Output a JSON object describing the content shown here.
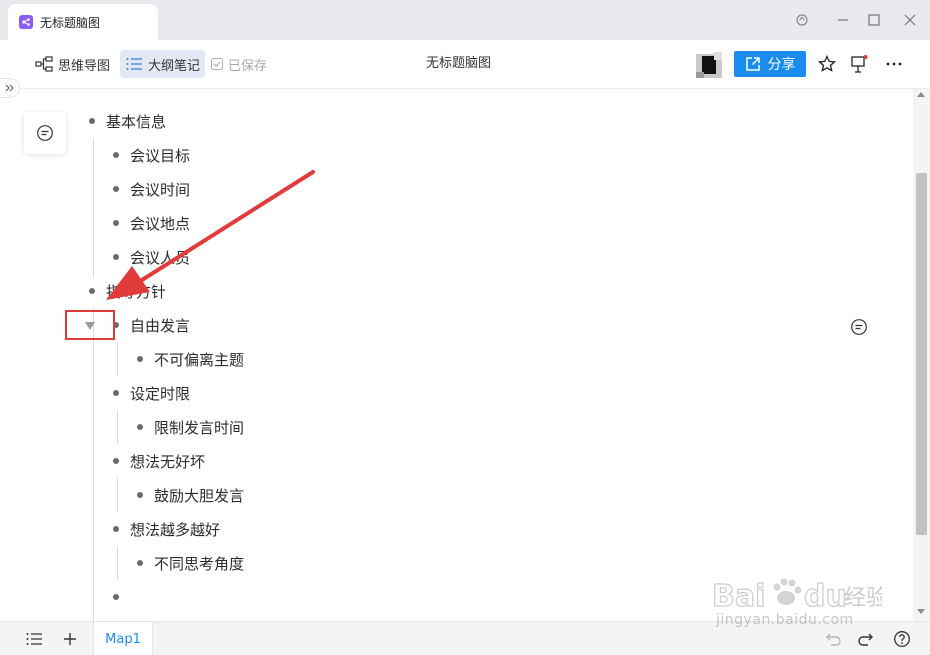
{
  "window": {
    "tab_title": "无标题脑图",
    "controls": [
      "sync-icon",
      "minimize-icon",
      "maximize-icon",
      "close-icon"
    ]
  },
  "toolbar": {
    "mindmap_label": "思维导图",
    "outline_label": "大纲笔记",
    "saved_label": "已保存",
    "doc_title": "无标题脑图",
    "share_label": "分享",
    "active_mode": "大纲笔记",
    "accent_color": "#1a8cf0"
  },
  "outline": {
    "nodes": [
      {
        "label": "基本信息",
        "level": 0
      },
      {
        "label": "会议目标",
        "level": 1
      },
      {
        "label": "会议时间",
        "level": 1
      },
      {
        "label": "会议地点",
        "level": 1
      },
      {
        "label": "会议人员",
        "level": 1
      },
      {
        "label": "指导方针",
        "level": 0
      },
      {
        "label": "自由发言",
        "level": 1,
        "collapsible": true
      },
      {
        "label": "不可偏离主题",
        "level": 2
      },
      {
        "label": "设定时限",
        "level": 1
      },
      {
        "label": "限制发言时间",
        "level": 2
      },
      {
        "label": "想法无好坏",
        "level": 1
      },
      {
        "label": "鼓励大胆发言",
        "level": 2
      },
      {
        "label": "想法越多越好",
        "level": 1
      },
      {
        "label": "不同思考角度",
        "level": 2
      },
      {
        "label": "",
        "level": 1
      }
    ]
  },
  "annotation": {
    "highlight_color": "#e23b3b",
    "target": "collapse-toggle"
  },
  "bottom": {
    "sheet_tab": "Map1"
  },
  "watermark": {
    "text": "Baidu经验",
    "url_text": "jingyan.baidu.com"
  }
}
